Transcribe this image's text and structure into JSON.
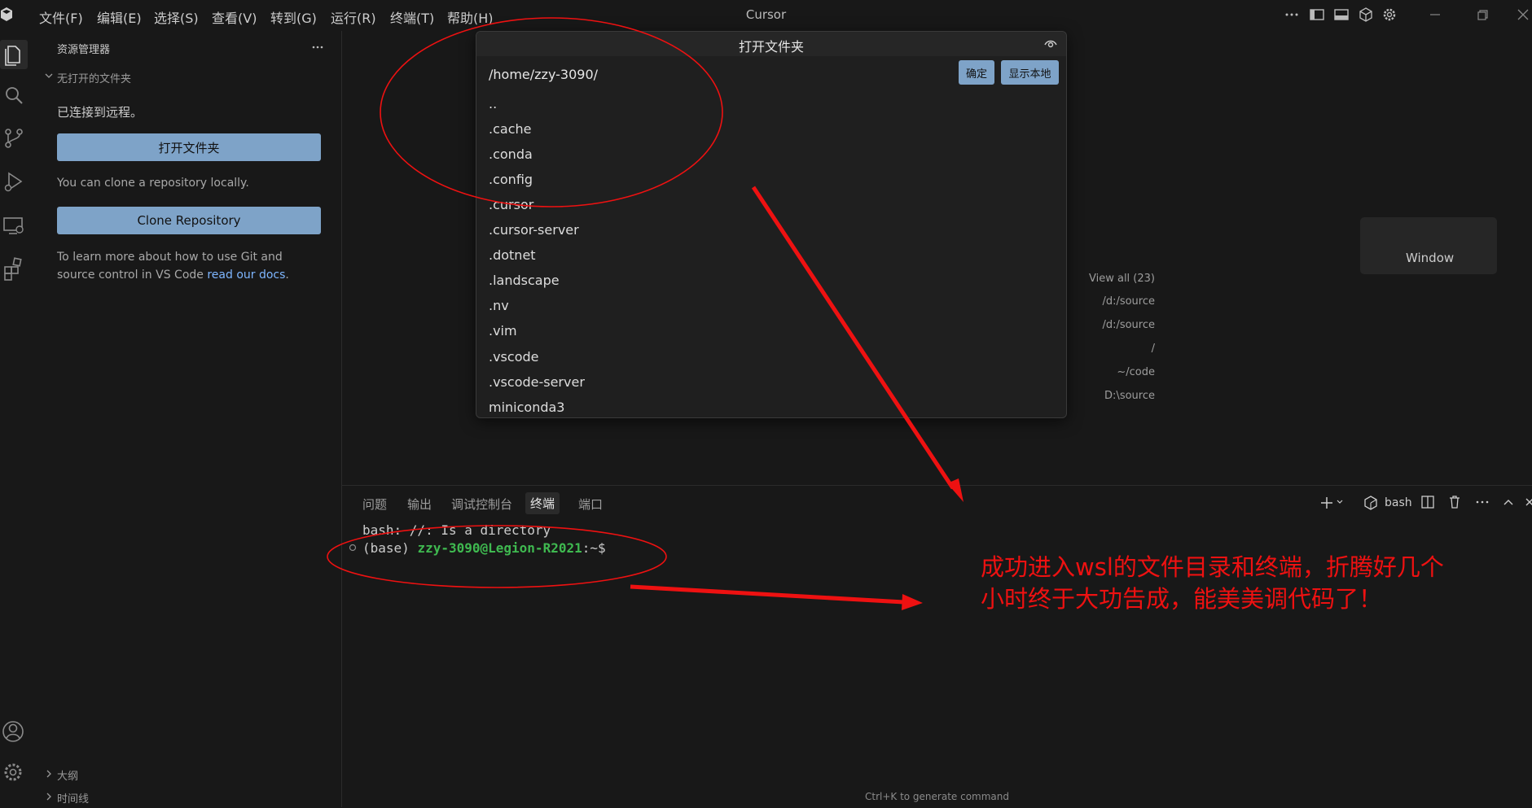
{
  "titlebar": {
    "menus": [
      "文件(F)",
      "编辑(E)",
      "选择(S)",
      "查看(V)",
      "转到(G)",
      "运行(R)",
      "终端(T)",
      "帮助(H)"
    ],
    "app_title": "Cursor"
  },
  "sidebar": {
    "header": "资源管理器",
    "no_folder_section": "无打开的文件夹",
    "connected_text": "已连接到远程。",
    "open_folder_button": "打开文件夹",
    "clone_hint": "You can clone a repository locally.",
    "clone_button": "Clone Repository",
    "learn_more_line1": "To learn more about how to use Git and",
    "learn_more_line2_prefix": "source control in VS Code ",
    "learn_more_link": "read our docs",
    "learn_more_suffix": ".",
    "outline_section": "大纲",
    "timeline_section": "时间线"
  },
  "editor": {
    "card_text": "Window",
    "recent": {
      "view_all": "View all (23)",
      "items": [
        "/d:/source",
        "/d:/source",
        "/",
        "~/code",
        "D:\\source"
      ]
    }
  },
  "dialog": {
    "title": "打开文件夹",
    "path": "/home/zzy-3090/",
    "ok_button": "确定",
    "show_local_button": "显示本地",
    "items": [
      "..",
      ".cache",
      ".conda",
      ".config",
      ".cursor",
      ".cursor-server",
      ".dotnet",
      ".landscape",
      ".nv",
      ".vim",
      ".vscode",
      ".vscode-server",
      "miniconda3"
    ]
  },
  "panel": {
    "tabs": [
      "问题",
      "输出",
      "调试控制台",
      "终端",
      "端口"
    ],
    "active_tab": "终端",
    "shell_label": "bash",
    "terminal": {
      "line1": "bash: //: Is a directory",
      "prompt_env": "(base) ",
      "prompt_user": "zzy-3090@Legion-R2021",
      "prompt_tail": ":~$"
    },
    "hint": "Ctrl+K to generate command"
  },
  "annotation": {
    "line1": "成功进入wsl的文件目录和终端，折腾好几个",
    "line2": "小时终于大功告成，能美美调代码了！"
  },
  "colors": {
    "accent_button": "#7ea3c8",
    "annotation_red": "#ee1111",
    "terminal_green": "#3fb950",
    "link_blue": "#7eb6ff"
  }
}
